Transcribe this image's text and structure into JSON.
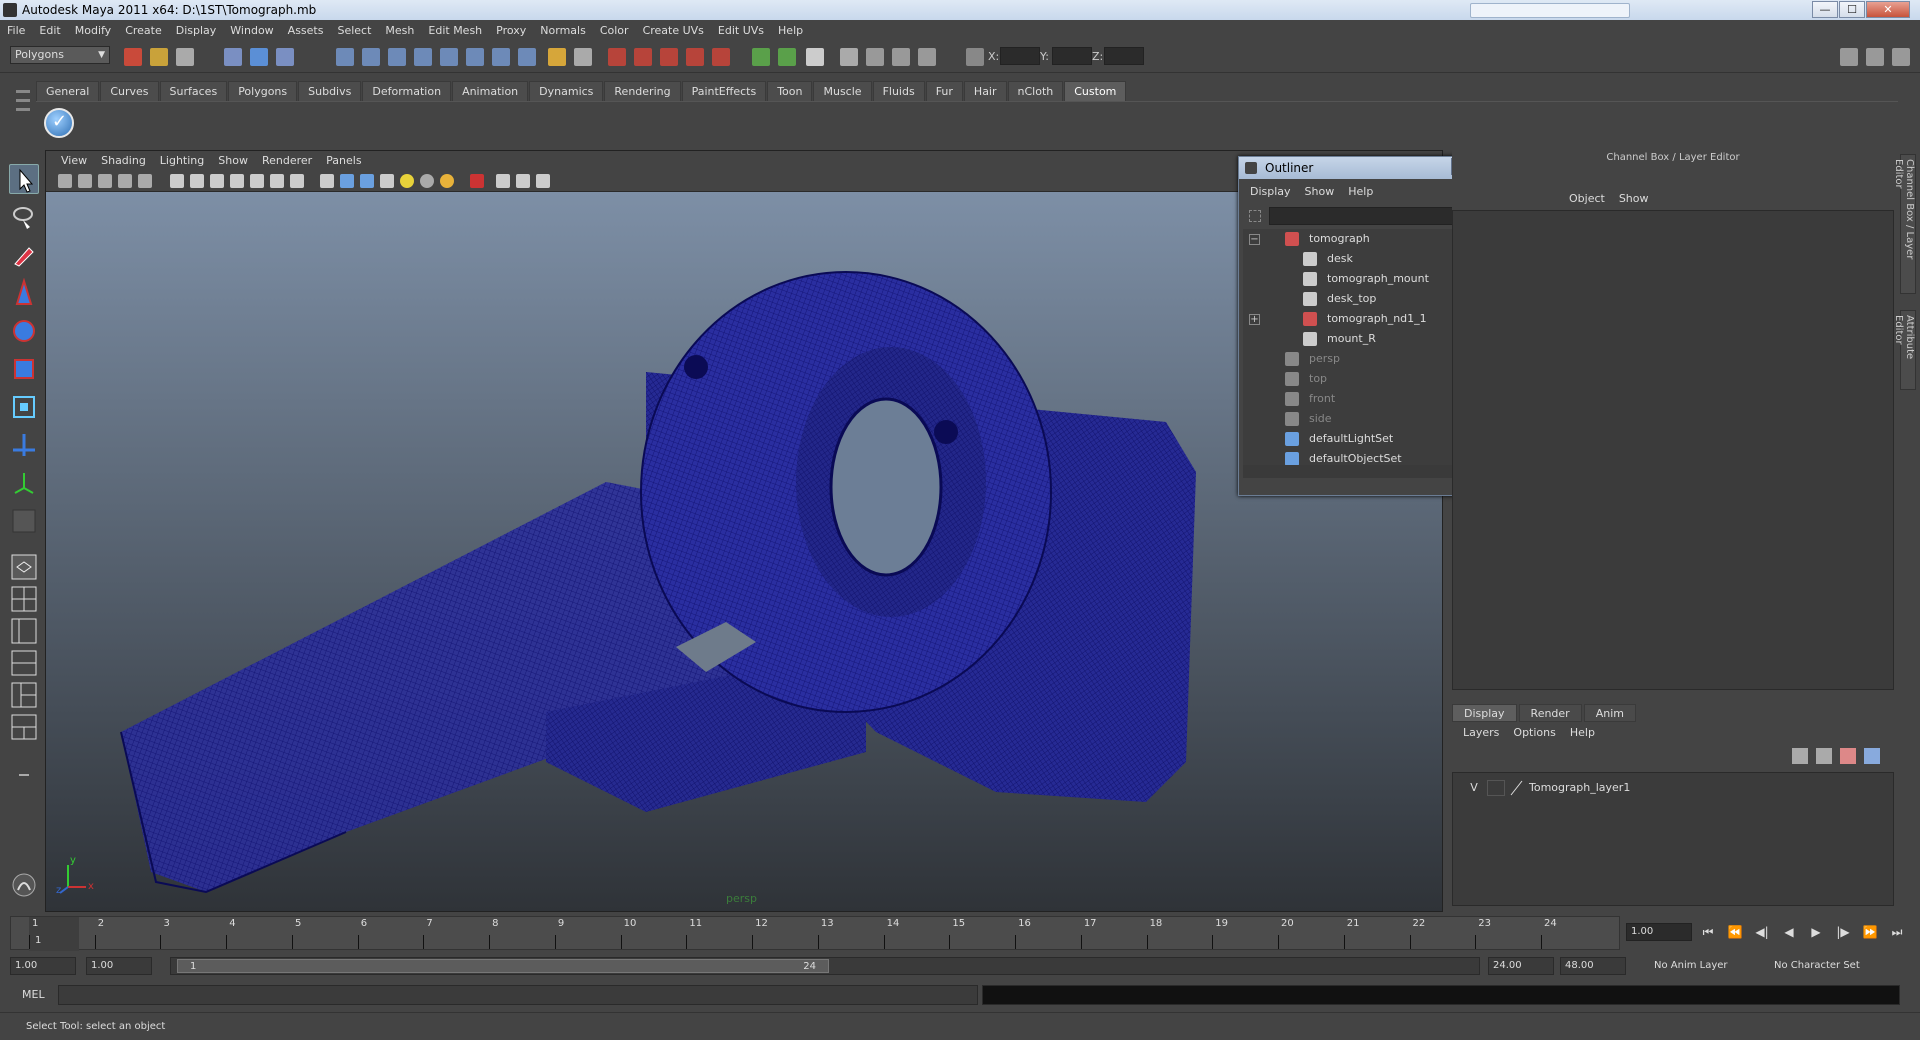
{
  "window": {
    "title": "Autodesk Maya 2011 x64: D:\\1ST\\Tomograph.mb",
    "controls": {
      "minimize": "—",
      "maximize": "☐",
      "close": "✕"
    }
  },
  "menubar": [
    "File",
    "Edit",
    "Modify",
    "Create",
    "Display",
    "Window",
    "Assets",
    "Select",
    "Mesh",
    "Edit Mesh",
    "Proxy",
    "Normals",
    "Color",
    "Create UVs",
    "Edit UVs",
    "Help"
  ],
  "statusline": {
    "mode": "Polygons",
    "coord_labels": {
      "x": "X:",
      "y": "Y:",
      "z": "Z:"
    }
  },
  "shelf": {
    "tabs": [
      "General",
      "Curves",
      "Surfaces",
      "Polygons",
      "Subdivs",
      "Deformation",
      "Animation",
      "Dynamics",
      "Rendering",
      "PaintEffects",
      "Toon",
      "Muscle",
      "Fluids",
      "Fur",
      "Hair",
      "nCloth",
      "Custom"
    ],
    "active_tab": "Custom"
  },
  "viewport": {
    "menu": [
      "View",
      "Shading",
      "Lighting",
      "Show",
      "Renderer",
      "Panels"
    ],
    "camera_label": "persp",
    "axis": {
      "y": "y",
      "x": "x",
      "z": "z"
    },
    "wire_color": "#14147a"
  },
  "outliner": {
    "title": "Outliner",
    "menu": [
      "Display",
      "Show",
      "Help"
    ],
    "items": [
      {
        "label": "tomograph",
        "type": "group",
        "expand": "−",
        "indent": 0,
        "dim": false
      },
      {
        "label": "desk",
        "type": "mesh",
        "indent": 1,
        "dim": false
      },
      {
        "label": "tomograph_mount",
        "type": "mesh",
        "indent": 1,
        "dim": false
      },
      {
        "label": "desk_top",
        "type": "mesh",
        "indent": 1,
        "dim": false
      },
      {
        "label": "tomograph_nd1_1",
        "type": "group",
        "expand": "+",
        "indent": 1,
        "dim": false
      },
      {
        "label": "mount_R",
        "type": "mesh",
        "indent": 1,
        "dim": false
      },
      {
        "label": "persp",
        "type": "camera",
        "indent": 0,
        "dim": true
      },
      {
        "label": "top",
        "type": "camera",
        "indent": 0,
        "dim": true
      },
      {
        "label": "front",
        "type": "camera",
        "indent": 0,
        "dim": true
      },
      {
        "label": "side",
        "type": "camera",
        "indent": 0,
        "dim": true
      },
      {
        "label": "defaultLightSet",
        "type": "set",
        "indent": 0,
        "dim": false
      },
      {
        "label": "defaultObjectSet",
        "type": "set",
        "indent": 0,
        "dim": false
      }
    ]
  },
  "channelbox": {
    "header": "Channel Box / Layer Editor",
    "menu": [
      "Object",
      "Show"
    ],
    "side_tabs": [
      "Channel Box / Layer Editor",
      "Attribute Editor"
    ]
  },
  "layer_editor": {
    "tabs": [
      "Display",
      "Render",
      "Anim"
    ],
    "active_tab": "Display",
    "menu": [
      "Layers",
      "Options",
      "Help"
    ],
    "layers": [
      {
        "visible": "V",
        "name": "Tomograph_layer1"
      }
    ]
  },
  "timeslider": {
    "ticks": [
      "1",
      "2",
      "3",
      "4",
      "5",
      "6",
      "7",
      "8",
      "9",
      "10",
      "11",
      "12",
      "13",
      "14",
      "15",
      "16",
      "17",
      "18",
      "19",
      "20",
      "21",
      "22",
      "23",
      "24"
    ],
    "current_frame": "1",
    "current_time_field": "1.00"
  },
  "playback": [
    "⏮",
    "⏪",
    "◀|",
    "◀",
    "▶",
    "|▶",
    "⏩",
    "⏭"
  ],
  "range": {
    "start": "1.00",
    "inner_start": "1.00",
    "slider_start": "1",
    "slider_end": "24",
    "end": "24.00",
    "outer_end": "48.00",
    "anim_layer": "No Anim Layer",
    "character_set": "No Character Set"
  },
  "command": {
    "label": "MEL"
  },
  "help_line": "Select Tool: select an object"
}
